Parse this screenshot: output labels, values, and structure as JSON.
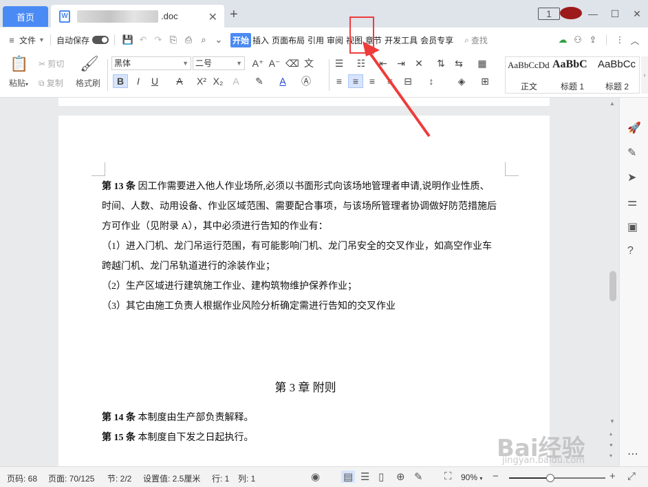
{
  "titlebar": {
    "home_tab": "首页",
    "doc_icon_letter": "W",
    "doc_suffix": ".doc",
    "close_symbol": "✕",
    "new_tab_symbol": "+",
    "window_badge": "1"
  },
  "menubar": {
    "file": "文件",
    "autosave": "自动保存",
    "tabs": [
      "开始",
      "插入",
      "页面布局",
      "引用",
      "审阅",
      "视图",
      "章节",
      "开发工具",
      "会员专享"
    ],
    "search_placeholder": "查找"
  },
  "ribbon": {
    "paste": "粘贴",
    "cut": "剪切",
    "copy": "复制",
    "format_painter": "格式刷",
    "font_name": "黑体",
    "font_size": "二号",
    "styles": [
      {
        "sample": "AaBbCcDd",
        "label": "正文"
      },
      {
        "sample": "AaBbC",
        "label": "标题 1"
      },
      {
        "sample": "AaBbCc",
        "label": "标题 2"
      }
    ]
  },
  "document": {
    "lines": [
      {
        "bold": "第 13 条",
        "text": "  因工作需要进入他人作业场所,必须以书面形式向该场地管理者申请,说明作业性质、"
      },
      {
        "bold": "",
        "text": "时间、人数、动用设备、作业区域范围、需要配合事项，与该场所管理者协调做好防范措施后"
      },
      {
        "bold": "",
        "text": "方可作业（见附录 A），其中必须进行告知的作业有："
      },
      {
        "bold": "",
        "text": "（1）进入门机、龙门吊运行范围，有可能影响门机、龙门吊安全的交叉作业，如高空作业车"
      },
      {
        "bold": "",
        "text": "跨越门机、龙门吊轨道进行的涂装作业；"
      },
      {
        "bold": "",
        "text": "（2）生产区域进行建筑施工作业、建构筑物维护保养作业；"
      },
      {
        "bold": "",
        "text": "（3）其它由施工负责人根据作业风险分析确定需进行告知的交叉作业"
      }
    ],
    "chapter": "第 3 章  附则",
    "lines2": [
      {
        "bold": "第 14 条",
        "text": "   本制度由生产部负责解释。"
      },
      {
        "bold": "第 15 条",
        "text": "   本制度自下发之日起执行。"
      }
    ]
  },
  "statusbar": {
    "page_code": "页码: 68",
    "page": "页面: 70/125",
    "section": "节: 2/2",
    "setting": "设置值: 2.5厘米",
    "row": "行: 1",
    "col": "列: 1",
    "zoom": "90%",
    "zoom_fraction": 0.43
  },
  "watermark": {
    "main": "Bai经验",
    "sub": "jingyan.baidu.com"
  },
  "colors": {
    "accent": "#4a8af4",
    "highlight": "#ee3b3b"
  }
}
